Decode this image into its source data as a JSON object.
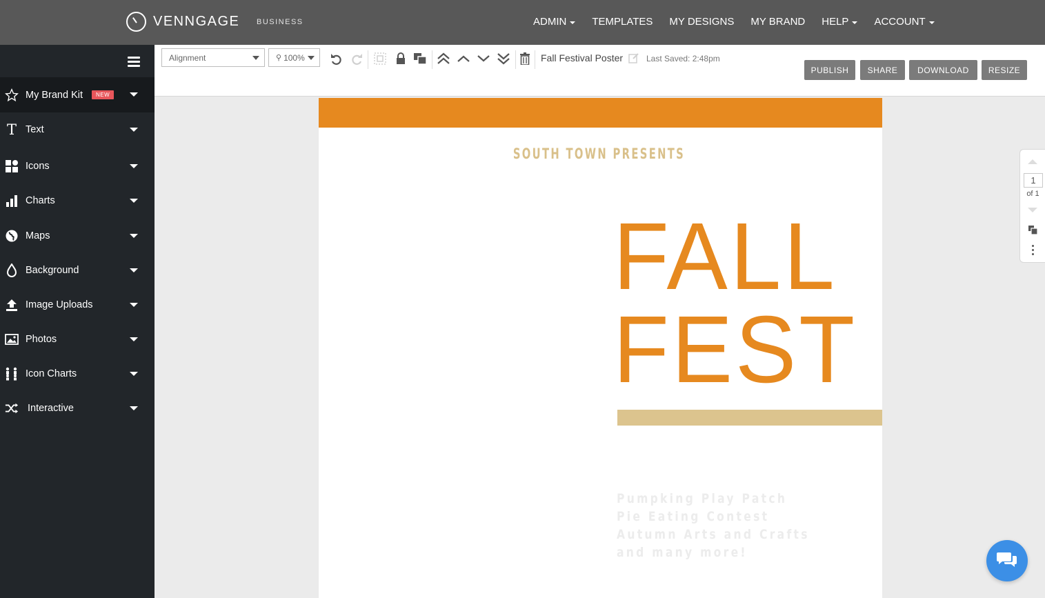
{
  "topbar": {
    "brand": "VENNGAGE",
    "plan": "BUSINESS",
    "nav": [
      {
        "label": "ADMIN",
        "has_caret": true
      },
      {
        "label": "TEMPLATES",
        "has_caret": false
      },
      {
        "label": "MY DESIGNS",
        "has_caret": false
      },
      {
        "label": "MY BRAND",
        "has_caret": false
      },
      {
        "label": "HELP",
        "has_caret": true
      },
      {
        "label": "ACCOUNT",
        "has_caret": true
      }
    ]
  },
  "sidebar": {
    "items": [
      {
        "label": "My Brand Kit",
        "icon": "star-icon",
        "badge": "NEW",
        "active": true
      },
      {
        "label": "Text",
        "icon": "text-icon"
      },
      {
        "label": "Icons",
        "icon": "shapes-icon"
      },
      {
        "label": "Charts",
        "icon": "bar-chart-icon"
      },
      {
        "label": "Maps",
        "icon": "globe-icon"
      },
      {
        "label": "Background",
        "icon": "droplet-icon"
      },
      {
        "label": "Image Uploads",
        "icon": "upload-icon"
      },
      {
        "label": "Photos",
        "icon": "image-icon"
      },
      {
        "label": "Icon Charts",
        "icon": "people-chart-icon"
      },
      {
        "label": "Interactive",
        "icon": "shuffle-icon"
      }
    ]
  },
  "toolbar": {
    "alignment": "Alignment",
    "zoom": "100%",
    "document_title": "Fall Festival Poster",
    "last_saved": "Last Saved: 2:48pm",
    "buttons": {
      "publish": "PUBLISH",
      "share": "SHARE",
      "download": "DOWNLOAD",
      "resize": "RESIZE"
    }
  },
  "poster": {
    "presents": "SOUTH TOWN PRESENTS",
    "title_line1": "FALL",
    "title_line2": "FEST",
    "events": [
      "Pumpking Play Patch",
      "Pie Eating Contest",
      "Autumn Arts and Crafts",
      "and many more!"
    ],
    "colors": {
      "orange": "#e6891f",
      "gold": "#dcc48e"
    }
  },
  "pages": {
    "current": "1",
    "total_label": "of 1"
  }
}
